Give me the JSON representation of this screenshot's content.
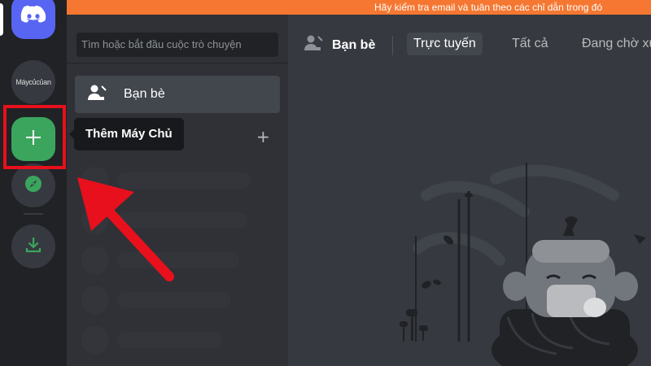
{
  "notice": {
    "text": "Hãy kiểm tra email và tuân theo các chỉ dẫn trong đó"
  },
  "rail": {
    "home_icon": "discord-logo-icon",
    "my_server_label": "Máycủcủan",
    "add_server_icon": "plus-icon",
    "explore_icon": "compass-icon",
    "download_icon": "download-icon"
  },
  "tooltip": {
    "text": "Thêm Máy Chủ"
  },
  "sidebar": {
    "search_placeholder": "Tìm hoặc bắt đầu cuộc trò chuyện",
    "friends_label": "Bạn bè",
    "friends_icon": "friends-wave-icon",
    "dm_add_icon": "plus-icon"
  },
  "header": {
    "friends_label": "Bạn bè",
    "friends_icon": "friends-wave-icon",
    "tabs": [
      {
        "label": "Trực tuyến",
        "active": true
      },
      {
        "label": "Tất cả",
        "active": false
      },
      {
        "label": "Đang chờ xử",
        "active": false
      }
    ]
  },
  "colors": {
    "notice": "#f57731",
    "rail": "#202225",
    "sidebar": "#2f3136",
    "main": "#36393f",
    "blurple": "#5865f2",
    "green": "#3ba55d",
    "annotation": "#e8101c"
  }
}
